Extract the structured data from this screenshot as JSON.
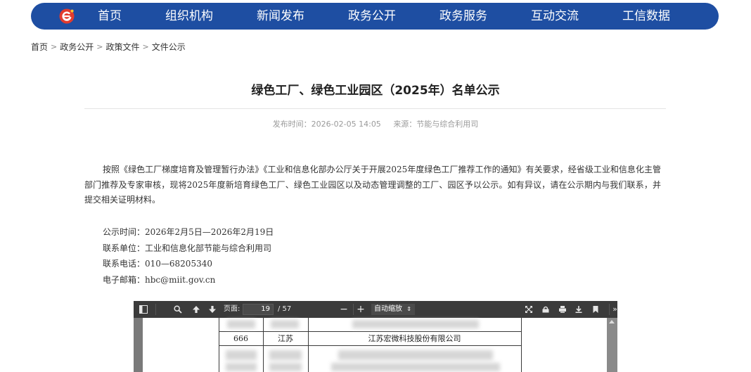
{
  "nav": {
    "brand_color": "#1e4ea2",
    "logo_icon": "miit-logo-icon",
    "items": [
      {
        "label": "首页"
      },
      {
        "label": "组织机构"
      },
      {
        "label": "新闻发布"
      },
      {
        "label": "政务公开"
      },
      {
        "label": "政务服务"
      },
      {
        "label": "互动交流"
      },
      {
        "label": "工信数据"
      }
    ]
  },
  "breadcrumb": {
    "items": [
      {
        "label": "首页"
      },
      {
        "label": "政务公开"
      },
      {
        "label": "政策文件"
      },
      {
        "label": "文件公示"
      }
    ],
    "separator": ">"
  },
  "article": {
    "title": "绿色工厂、绿色工业园区（2025年）名单公示",
    "publish_label": "发布时间：2026-02-05 14:05",
    "source_label": "来源：节能与综合利用司",
    "paragraph": "按照《绿色工厂梯度培育及管理暂行办法》《工业和信息化部办公厅关于开展2025年度绿色工厂推荐工作的通知》有关要求，经省级工业和信息化主管部门推荐及专家审核，现将2025年度新培育绿色工厂、绿色工业园区以及动态管理调整的工厂、园区予以公示。如有异议，请在公示期内与我们联系，并提交相关证明材料。",
    "contact": {
      "period": "公示时间：2026年2月5日—2026年2月19日",
      "unit": "联系单位：工业和信息化部节能与综合利用司",
      "phone": "联系电话：010—68205340",
      "email": "电子邮箱：hbc@miit.gov.cn"
    }
  },
  "pdf_viewer": {
    "toolbar": {
      "sidebar_icon": "sidebar-toggle-icon",
      "search_icon": "search-icon",
      "prev_icon": "arrow-up-icon",
      "next_icon": "arrow-down-icon",
      "page_label": "页面:",
      "page_value": "19",
      "page_total": "/ 57",
      "zoom_out": "−",
      "zoom_in": "+",
      "zoom_value": "自动缩放",
      "fullscreen_icon": "fullscreen-icon",
      "open_icon": "open-file-icon",
      "print_icon": "print-icon",
      "download_icon": "download-icon",
      "bookmark_icon": "bookmark-icon",
      "more_icon": "double-chevron-right-icon"
    },
    "table_row": {
      "index": "666",
      "province": "江苏",
      "company": "江苏宏微科技股份有限公司"
    }
  }
}
